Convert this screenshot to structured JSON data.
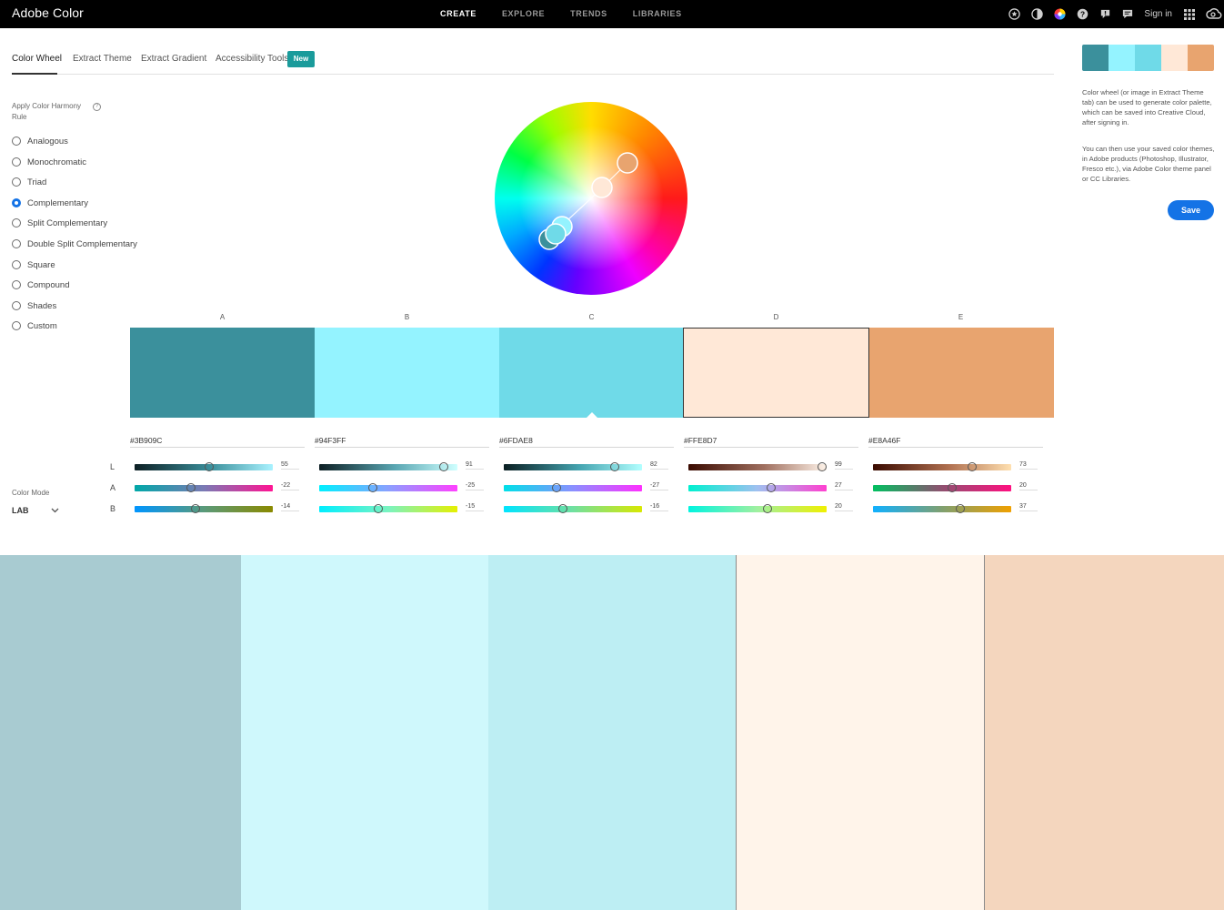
{
  "app": {
    "title": "Adobe Color"
  },
  "topnav": [
    {
      "label": "CREATE",
      "active": true
    },
    {
      "label": "EXPLORE",
      "active": false
    },
    {
      "label": "TRENDS",
      "active": false
    },
    {
      "label": "LIBRARIES",
      "active": false
    }
  ],
  "header": {
    "signin_label": "Sign in"
  },
  "tabs": [
    {
      "label": "Color Wheel",
      "active": true
    },
    {
      "label": "Extract Theme",
      "active": false
    },
    {
      "label": "Extract Gradient",
      "active": false
    },
    {
      "label": "Accessibility Tools",
      "active": false
    }
  ],
  "badge": {
    "label": "New"
  },
  "harmony": {
    "title": "Apply Color Harmony Rule",
    "help_glyph": "?",
    "rules": [
      {
        "label": "Analogous",
        "checked": false
      },
      {
        "label": "Monochromatic",
        "checked": false
      },
      {
        "label": "Triad",
        "checked": false
      },
      {
        "label": "Complementary",
        "checked": true
      },
      {
        "label": "Split Complementary",
        "checked": false
      },
      {
        "label": "Double Split Complementary",
        "checked": false
      },
      {
        "label": "Square",
        "checked": false
      },
      {
        "label": "Compound",
        "checked": false
      },
      {
        "label": "Shades",
        "checked": false
      },
      {
        "label": "Custom",
        "checked": false
      }
    ]
  },
  "colors": [
    {
      "letter": "A",
      "hex": "#3B909C",
      "L": 55,
      "A": -22,
      "B": -14,
      "L_pos": 0.54,
      "A_pos": 0.41,
      "B_pos": 0.44
    },
    {
      "letter": "B",
      "hex": "#94F3FF",
      "L": 91,
      "A": -25,
      "B": -15,
      "L_pos": 0.9,
      "A_pos": 0.39,
      "B_pos": 0.43
    },
    {
      "letter": "C",
      "hex": "#6FDAE8",
      "L": 82,
      "A": -27,
      "B": -16,
      "L_pos": 0.8,
      "A_pos": 0.38,
      "B_pos": 0.43
    },
    {
      "letter": "D",
      "hex": "#FFE8D7",
      "L": 99,
      "A": 27,
      "B": 20,
      "L_pos": 0.97,
      "A_pos": 0.6,
      "B_pos": 0.57
    },
    {
      "letter": "E",
      "hex": "#E8A46F",
      "L": 73,
      "A": 20,
      "B": 37,
      "L_pos": 0.72,
      "A_pos": 0.57,
      "B_pos": 0.63
    }
  ],
  "selected_index": 3,
  "axis_labels": [
    "L",
    "A",
    "B"
  ],
  "color_mode": {
    "title": "Color Mode",
    "value": "LAB"
  },
  "preview_colors": [
    "#A8CBD1",
    "#CFF8FC",
    "#BDEEF3",
    "#FFF4EA",
    "#F4D6BE"
  ],
  "info": {
    "p1": "Color wheel (or image in Extract Theme tab) can be used to generate color palette, which can be saved into Creative Cloud, after signing in.",
    "p2": "You can then use your saved color themes, in Adobe products (Photoshop, Illustrator, Fresco etc.), via Adobe Color theme panel or CC Libraries."
  },
  "save_label": "Save"
}
